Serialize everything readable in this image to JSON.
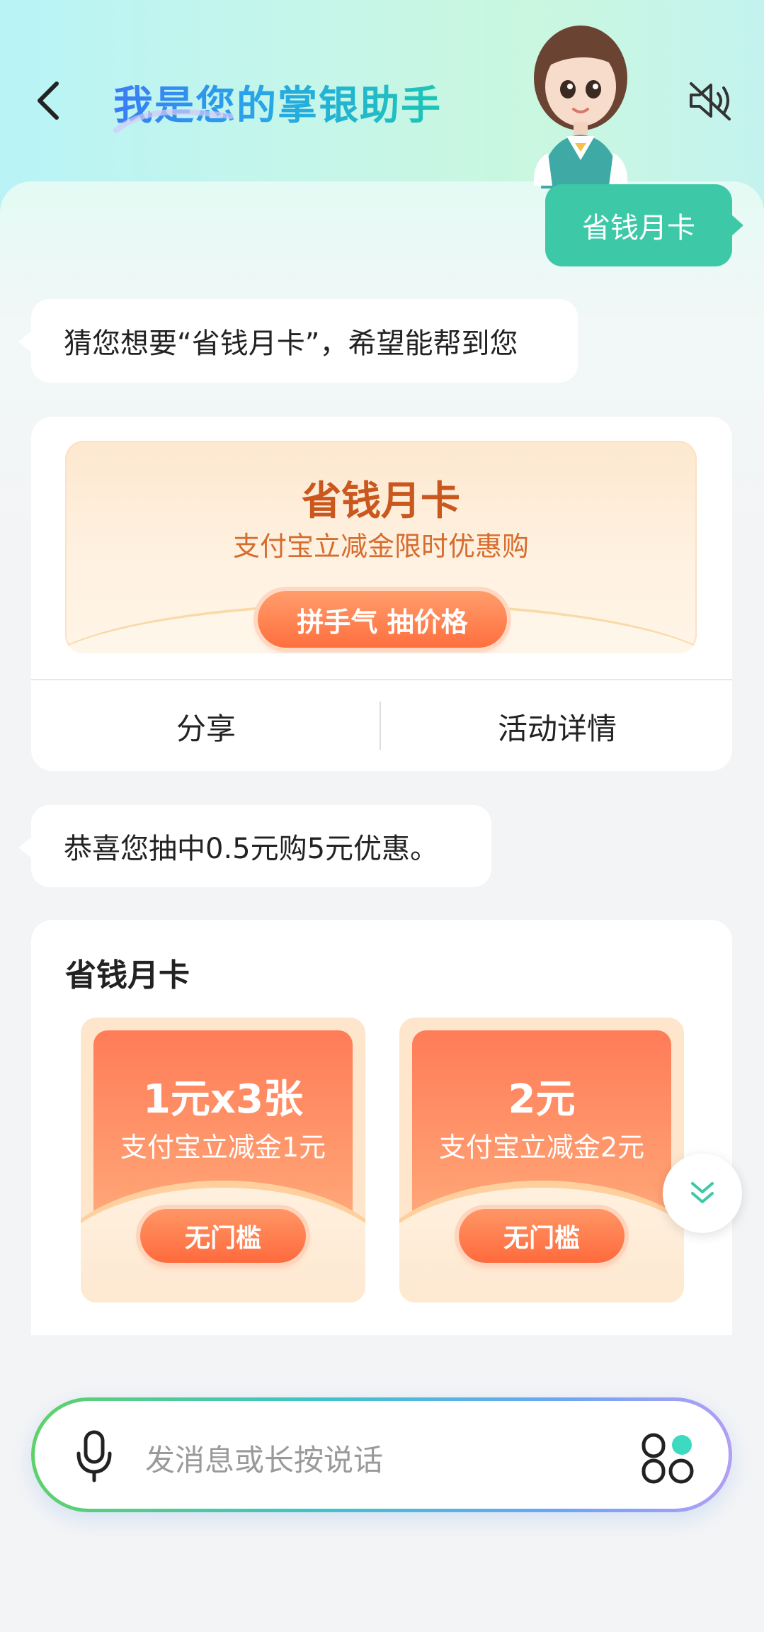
{
  "header": {
    "title": "我是您的掌银助手"
  },
  "messages": {
    "user_query": "省钱月卡",
    "bot_reply_1": "猜您想要“省钱月卡”，希望能帮到您",
    "bot_reply_2": "恭喜您抽中0.5元购5元优惠。"
  },
  "promo_card": {
    "title": "省钱月卡",
    "subtitle": "支付宝立减金限时优惠购",
    "button": "拼手气 抽价格",
    "actions": [
      "分享",
      "活动详情"
    ]
  },
  "coupon_card": {
    "title": "省钱月卡",
    "coupons": [
      {
        "amount": "1元x3张",
        "desc": "支付宝立减金1元",
        "button": "无门槛"
      },
      {
        "amount": "2元",
        "desc": "支付宝立减金2元",
        "button": "无门槛"
      }
    ]
  },
  "input": {
    "placeholder": "发消息或长按说话"
  },
  "colors": {
    "accent_green": "#3dc9a8",
    "promo_orange": "#ff6f3f",
    "title_gradient_start": "#3b7cf5",
    "title_gradient_end": "#1ec6b4"
  },
  "icons": [
    "back-icon",
    "avatar-assistant",
    "mute-icon",
    "chevron-double-down-icon",
    "microphone-icon",
    "apps-icon"
  ]
}
